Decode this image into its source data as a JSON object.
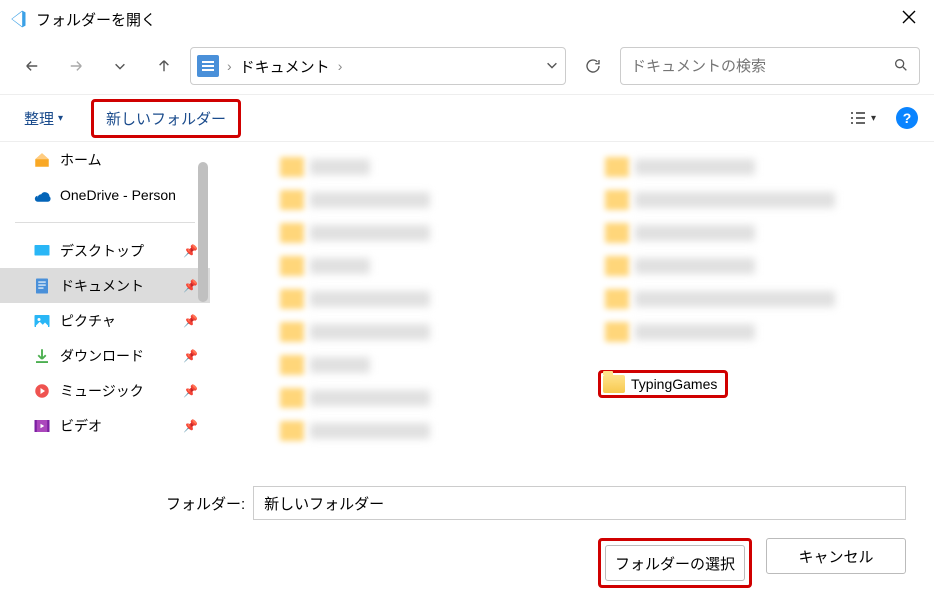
{
  "title": "フォルダーを開く",
  "breadcrumb": {
    "current": "ドキュメント"
  },
  "search": {
    "placeholder": "ドキュメントの検索"
  },
  "toolbar": {
    "organize": "整理",
    "new_folder": "新しいフォルダー"
  },
  "sidebar": {
    "home": "ホーム",
    "onedrive": "OneDrive - Person",
    "desktop": "デスクトップ",
    "documents": "ドキュメント",
    "pictures": "ピクチャ",
    "downloads": "ダウンロード",
    "music": "ミュージック",
    "videos": "ビデオ"
  },
  "content": {
    "typing_games": "TypingGames"
  },
  "footer": {
    "folder_label": "フォルダー:",
    "folder_value": "新しいフォルダー",
    "select": "フォルダーの選択",
    "cancel": "キャンセル"
  }
}
